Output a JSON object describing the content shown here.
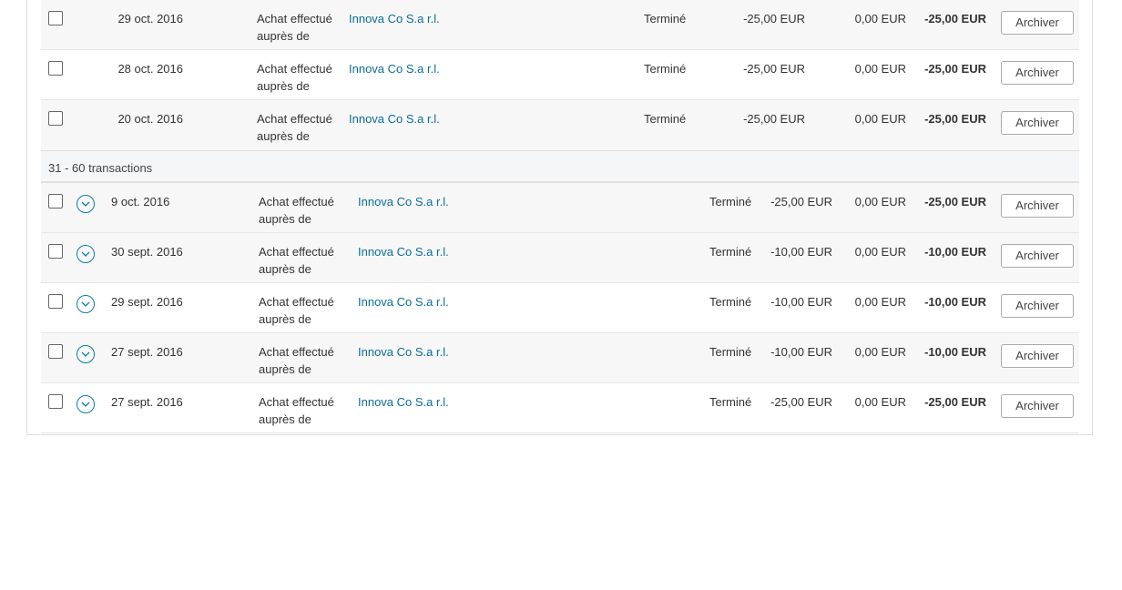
{
  "group1": {
    "rows": [
      {
        "date": "29 oct. 2016",
        "description": "Achat effectué auprès de",
        "merchant": "Innova Co S.a r.l.",
        "status": "Terminé",
        "gross": "-25,00 EUR",
        "fee": "0,00 EUR",
        "net": "-25,00 EUR",
        "action": "Archiver"
      },
      {
        "date": "28 oct. 2016",
        "description": "Achat effectué auprès de",
        "merchant": "Innova Co S.a r.l.",
        "status": "Terminé",
        "gross": "-25,00 EUR",
        "fee": "0,00 EUR",
        "net": "-25,00 EUR",
        "action": "Archiver"
      },
      {
        "date": "20 oct. 2016",
        "description": "Achat effectué auprès de",
        "merchant": "Innova Co S.a r.l.",
        "status": "Terminé",
        "gross": "-25,00 EUR",
        "fee": "0,00 EUR",
        "net": "-25,00 EUR",
        "action": "Archiver"
      }
    ]
  },
  "separator": {
    "label": "31 - 60 transactions"
  },
  "group2": {
    "rows": [
      {
        "date": "9 oct. 2016",
        "description": "Achat effectué auprès de",
        "merchant": "Innova Co S.a r.l.",
        "status": "Terminé",
        "gross": "-25,00 EUR",
        "fee": "0,00 EUR",
        "net": "-25,00 EUR",
        "action": "Archiver"
      },
      {
        "date": "30 sept. 2016",
        "description": "Achat effectué auprès de",
        "merchant": "Innova Co S.a r.l.",
        "status": "Terminé",
        "gross": "-10,00 EUR",
        "fee": "0,00 EUR",
        "net": "-10,00 EUR",
        "action": "Archiver"
      },
      {
        "date": "29 sept. 2016",
        "description": "Achat effectué auprès de",
        "merchant": "Innova Co S.a r.l.",
        "status": "Terminé",
        "gross": "-10,00 EUR",
        "fee": "0,00 EUR",
        "net": "-10,00 EUR",
        "action": "Archiver"
      },
      {
        "date": "27 sept. 2016",
        "description": "Achat effectué auprès de",
        "merchant": "Innova Co S.a r.l.",
        "status": "Terminé",
        "gross": "-10,00 EUR",
        "fee": "0,00 EUR",
        "net": "-10,00 EUR",
        "action": "Archiver"
      },
      {
        "date": "27 sept. 2016",
        "description": "Achat effectué auprès de",
        "merchant": "Innova Co S.a r.l.",
        "status": "Terminé",
        "gross": "-25,00 EUR",
        "fee": "0,00 EUR",
        "net": "-25,00 EUR",
        "action": "Archiver"
      }
    ]
  },
  "icons": {
    "expand": "chevron-down-circle-icon",
    "select": "checkbox-icon"
  },
  "colors": {
    "link": "#0b6e99",
    "accent": "#0b7ea8",
    "row_alt": "#f7f7f7"
  }
}
